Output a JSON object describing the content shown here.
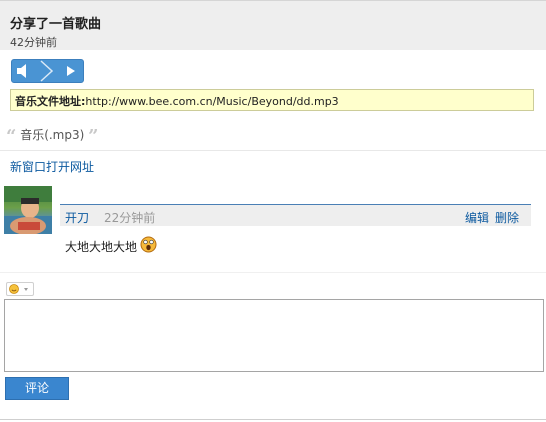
{
  "post": {
    "title": "分享了一首歌曲",
    "time": "42分钟前"
  },
  "player": {
    "controls": [
      "volume-icon",
      "play-pause-icon",
      "next-icon"
    ]
  },
  "music": {
    "url_label": "音乐文件地址:",
    "url": "http://www.bee.com.cn/Music/Beyond/dd.mp3",
    "quote_open": "“",
    "quote_close": "”",
    "file_desc": "音乐(.mp3)",
    "open_new_window": "新窗口打开网址"
  },
  "comment": {
    "author": "开刀",
    "time": "22分钟前",
    "edit_label": "编辑",
    "delete_label": "删除",
    "text": "大地大地大地",
    "emoji_icon": "surprised-face-icon"
  },
  "reply": {
    "emoji_picker_icon": "smiley-icon",
    "textarea_value": "",
    "submit_label": "评论"
  },
  "colors": {
    "accent": "#3a86cf",
    "link": "#0d5aa0",
    "url_bg": "#ffffcc"
  }
}
